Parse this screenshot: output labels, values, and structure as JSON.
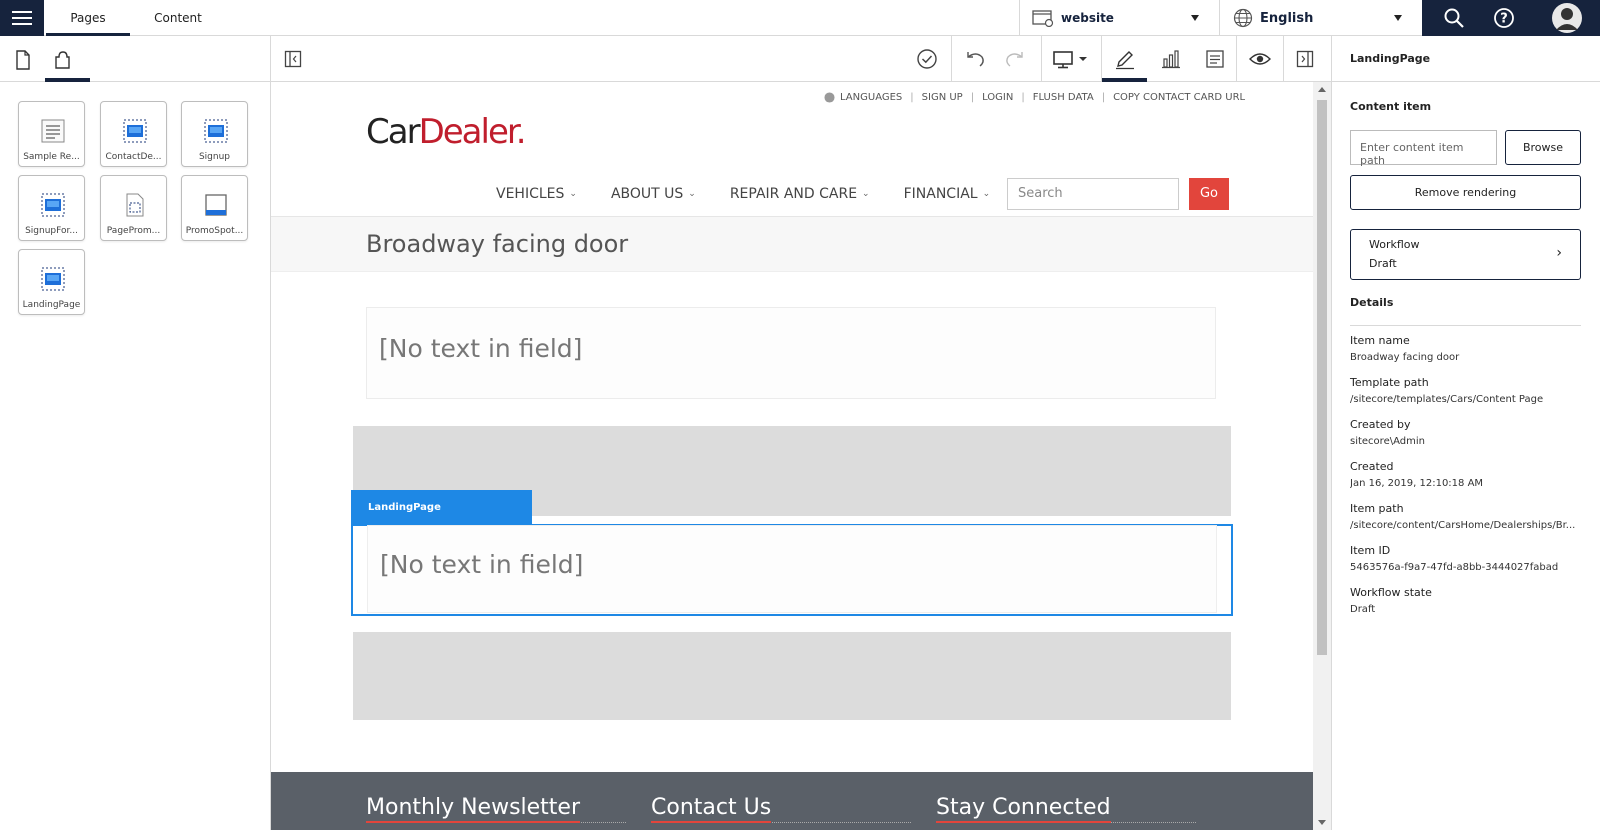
{
  "topbar": {
    "tabs": [
      "Pages",
      "Content"
    ],
    "site": "website",
    "language": "English",
    "icons": [
      "menu-icon",
      "website-icon",
      "globe-icon",
      "search-icon",
      "help-icon",
      "avatar"
    ]
  },
  "left_panel": {
    "tabs": [
      "page-icon",
      "components-icon"
    ],
    "components": [
      {
        "label": "Sample Re...",
        "icon": "text-rendering-icon"
      },
      {
        "label": "ContactDe...",
        "icon": "rendering-icon"
      },
      {
        "label": "Signup",
        "icon": "rendering-icon"
      },
      {
        "label": "SignupFor...",
        "icon": "rendering-icon"
      },
      {
        "label": "PageProm...",
        "icon": "page-outline-icon"
      },
      {
        "label": "PromoSpot...",
        "icon": "promo-icon"
      },
      {
        "label": "LandingPage",
        "icon": "rendering-icon"
      }
    ]
  },
  "toolbar": {
    "icons": [
      "toggle-left-panel-icon",
      "check-icon",
      "undo-icon",
      "redo-icon",
      "device-icon",
      "edit-icon",
      "analytics-icon",
      "page-details-icon",
      "preview-icon",
      "toggle-right-panel-icon"
    ]
  },
  "canvas": {
    "util_links": [
      "LANGUAGES",
      "SIGN UP",
      "LOGIN",
      "FLUSH DATA",
      "COPY CONTACT CARD URL"
    ],
    "logo": {
      "part1": "Car",
      "part2": "Dealer."
    },
    "nav": [
      "VEHICLES",
      "ABOUT US",
      "REPAIR AND CARE",
      "FINANCIAL"
    ],
    "search_placeholder": "Search",
    "go_label": "Go",
    "page_title": "Broadway facing door",
    "field1": "[No text in field]",
    "rendering_tag": "LandingPage",
    "field2": "[No text in field]",
    "footer": [
      "Monthly Newsletter",
      "Contact Us",
      "Stay Connected"
    ]
  },
  "right_panel": {
    "header": "LandingPage",
    "content_item_label": "Content item",
    "content_item_placeholder": "Enter content item path",
    "browse_label": "Browse",
    "remove_label": "Remove rendering",
    "workflow_label": "Workflow",
    "workflow_value": "Draft",
    "details_label": "Details",
    "details": [
      {
        "key": "Item name",
        "value": "Broadway facing door"
      },
      {
        "key": "Template path",
        "value": "/sitecore/templates/Cars/Content Page"
      },
      {
        "key": "Created by",
        "value": "sitecore\\Admin"
      },
      {
        "key": "Created",
        "value": "Jan 16, 2019, 12:10:18 AM"
      },
      {
        "key": "Item path",
        "value": "/sitecore/content/CarsHome/Dealerships/Br..."
      },
      {
        "key": "Item ID",
        "value": "5463576a-f9a7-47fd-a8bb-3444027fabad"
      },
      {
        "key": "Workflow state",
        "value": "Draft"
      }
    ]
  }
}
